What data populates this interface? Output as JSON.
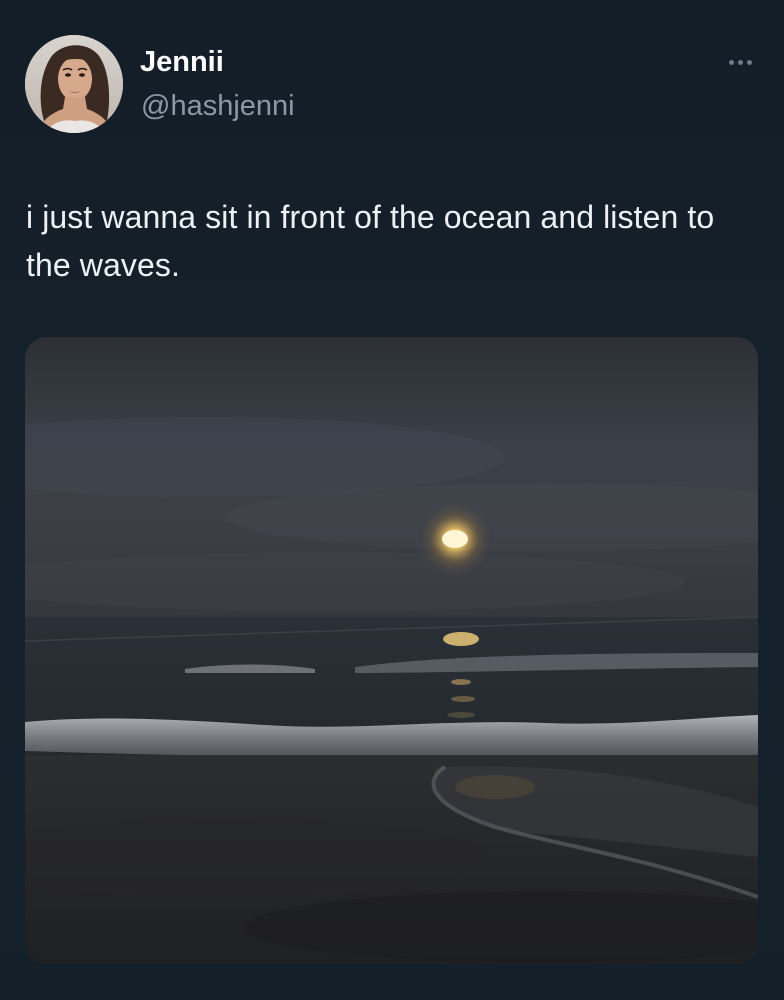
{
  "tweet": {
    "author": {
      "display_name": "Jennii",
      "handle": "@hashjenni",
      "avatar_icon": "profile-photo"
    },
    "more_icon": "more-horizontal-icon",
    "text": "i just wanna sit in front of the ocean and listen to the waves.",
    "media": {
      "type": "photo",
      "subject": "moon over the ocean at night with waves on the beach"
    }
  },
  "colors": {
    "background": "#15202b",
    "name_text": "#ffffff",
    "handle_text": "#8b98a5",
    "body_text": "#eef1f4"
  }
}
